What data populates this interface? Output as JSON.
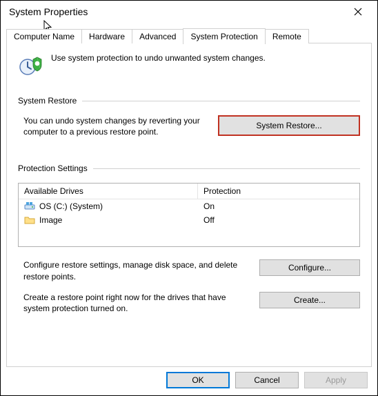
{
  "window": {
    "title": "System Properties"
  },
  "tabs": {
    "items": [
      {
        "label": "Computer Name"
      },
      {
        "label": "Hardware"
      },
      {
        "label": "Advanced"
      },
      {
        "label": "System Protection"
      },
      {
        "label": "Remote"
      }
    ],
    "active_index": 3
  },
  "intro_text": "Use system protection to undo unwanted system changes.",
  "sections": {
    "restore": {
      "heading": "System Restore",
      "text": "You can undo system changes by reverting your computer to a previous restore point.",
      "button": "System Restore..."
    },
    "protection": {
      "heading": "Protection Settings",
      "columns": {
        "drive": "Available Drives",
        "protection": "Protection"
      },
      "rows": [
        {
          "name": "OS (C:) (System)",
          "status": "On",
          "icon": "system-drive"
        },
        {
          "name": "Image",
          "status": "Off",
          "icon": "folder"
        }
      ],
      "configure_text": "Configure restore settings, manage disk space, and delete restore points.",
      "configure_button": "Configure...",
      "create_text": "Create a restore point right now for the drives that have system protection turned on.",
      "create_button": "Create..."
    }
  },
  "footer": {
    "ok": "OK",
    "cancel": "Cancel",
    "apply": "Apply"
  }
}
